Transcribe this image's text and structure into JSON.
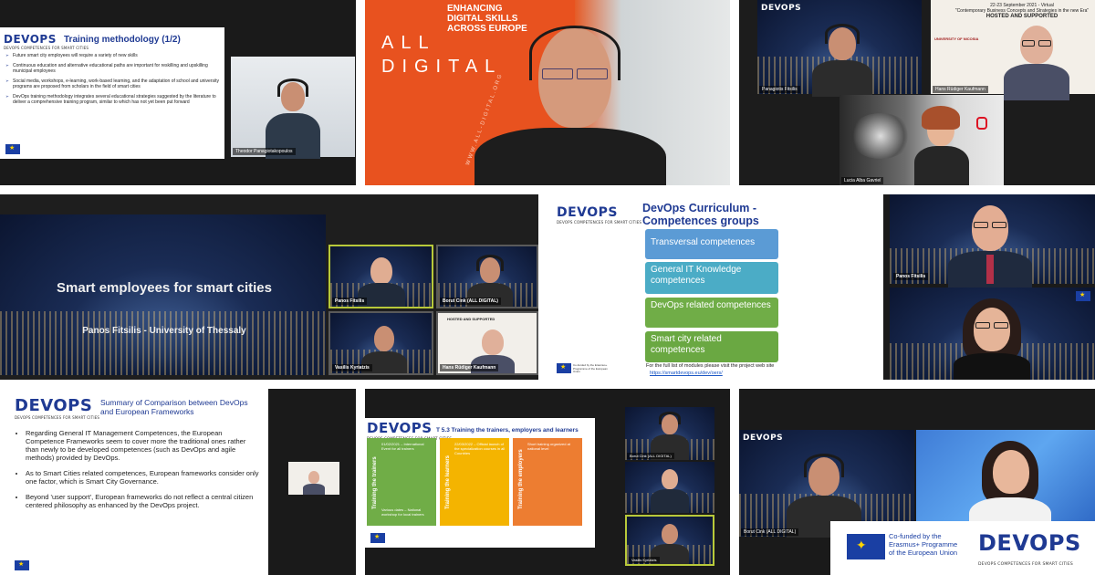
{
  "tile1": {
    "logo": "DEVOPS",
    "logo_sub": "DEVOPS COMPETENCES FOR SMART CITIES",
    "title": "Training methodology (1/2)",
    "bullets": [
      "Future smart city employees will require a variety of new skills",
      "Continuous education and alternative educational paths are important for reskilling and upskilling municipal employees",
      "Social media, workshops, e-learning, work-based learning, and the adaptation of school and university programs are proposed from scholars in the field of smart cities",
      "DevOps training methodology integrates several educational strategies suggested by the literature to deliver a comprehensive training program, similar to which has not yet been put forward"
    ],
    "speaker": "Theodor Panagiotakopoulos"
  },
  "tile2": {
    "banner_line1": "ENHANCING",
    "banner_line2": "DIGITAL SKILLS",
    "banner_line3": "ACROSS EUROPE",
    "brand_line1": "ALL",
    "brand_line2": "DIGITAL",
    "url": "WWW.ALL-DIGITAL.ORG"
  },
  "tile3": {
    "logo": "DEVOPS",
    "event_line1": "22-23 September 2021 - Virtual",
    "event_line2": "\"Contemporary Business Concepts and Strategies in the new Era\"",
    "event_line3": "HOSTED AND SUPPORTED",
    "university": "UNIVERSITY OF NICOSIA",
    "name1": "Panagiotis Fitsilis",
    "name2": "Hans Rüdiger Kaufmann",
    "name3": "Lucia Alba Gavriel"
  },
  "tile4": {
    "title": "Smart employees for smart cities",
    "subtitle": "Panos Fitsilis - University of Thessaly",
    "name1": "Panos Fitsilis",
    "name2": "Borut Cink (ALL DIGITAL)",
    "name3": "Vasilis Kyriatzis",
    "name4": "Hans Rüdiger Kaufmann",
    "hosted": "HOSTED AND SUPPORTED"
  },
  "tile5": {
    "logo": "DEVOPS",
    "logo_sub": "DEVOPS COMPETENCES FOR SMART CITIES",
    "title": "DevOps Curriculum - Competences groups",
    "groups": [
      "Transversal competences",
      "General IT Knowledge competences",
      "DevOps related competences",
      "Smart city related competences"
    ],
    "footer": "For the full list of modules please visit the project web site",
    "link": "https://smartdevops.eu/dev/oers/",
    "eu_text": "Co-funded by the Erasmus+ Programme of the European Union",
    "name1": "Panos Fitsilis"
  },
  "tile6": {
    "logo": "DEVOPS",
    "logo_sub": "DEVOPS COMPETENCES FOR SMART CITIES",
    "title": "Summary of Comparison between DevOps and European Frameworks",
    "bullets": [
      "Regarding General IT Management Competences, the European Competence Frameworks seem to cover more the traditional ones rather than newly to be developed competences (such as DevOps and agile methods) provided by DevOps.",
      "As to Smart Cities related competences, European frameworks consider only one factor, which is Smart City Governance.",
      "Beyond 'user support', European frameworks do not reflect a central citizen centered philosophy as enhanced by the DevOps project."
    ]
  },
  "tile7": {
    "logo": "DEVOPS",
    "logo_sub": "DEVOPS COMPETENCES FOR SMART CITIES",
    "title": "T 5.3 Training the trainers, employers and learners",
    "col1_label": "Training the trainers",
    "col2_label": "Training the learners",
    "col3_label": "Training the employers",
    "col1_head": "01/02/2021 – International Event for all trainers",
    "col2_head": "22/03/2022 – Official launch of the specialization courses in all Countries",
    "col3_head": "Short training organized at national level",
    "col1_foot": "Various dates – National workshop for local trainers",
    "name1": "Borut Cink (ALL DIGITAL)",
    "name2": "Vasilis Kyriatzis"
  },
  "tile8": {
    "eu_text_line1": "Co-funded by the",
    "eu_text_line2": "Erasmus+ Programme",
    "eu_text_line3": "of the European Union",
    "logo": "DEVOPS",
    "logo_sub": "DEVOPS COMPETENCES FOR SMART CITIES",
    "name1": "Borut Cink (ALL DIGITAL)"
  },
  "colors": {
    "devops_blue": "#1f3a93",
    "all_digital_orange": "#e8521f",
    "box_blue": "#5b9bd5",
    "box_green": "#70ad47",
    "accent_yellow": "#f4b400",
    "accent_orange": "#ed7d31"
  }
}
